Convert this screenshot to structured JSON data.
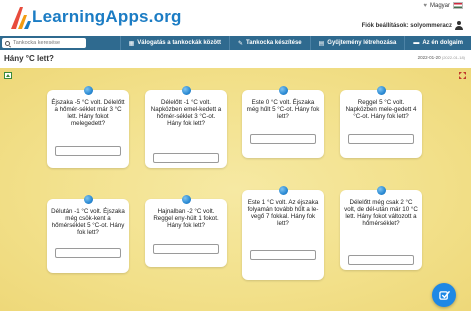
{
  "header": {
    "logo_text": "LearningApps.org",
    "language": "Magyar",
    "settings_link": "Fiók beállítások: solyommeracz"
  },
  "nav": {
    "search_placeholder": "Tankocka keresése",
    "items": [
      {
        "label": "Válogatás a tankockák között",
        "icon": "grid-icon"
      },
      {
        "label": "Tankocka készítése",
        "icon": "pencil-icon"
      },
      {
        "label": "Gyűjtemény létrehozása",
        "icon": "collection-icon"
      },
      {
        "label": "Az én dolgaim",
        "icon": "folder-icon"
      }
    ]
  },
  "page": {
    "title": "Hány °C lett?",
    "date": "2022-01-20",
    "date_small": "(2022-01-18)"
  },
  "cards": [
    {
      "text": "Éjszaka -5 °C volt. Délelőtt a hőmér-séklet már 3 °C lett. Hány fokot melegedett?",
      "answer": ""
    },
    {
      "text": "Délelőtt -1 °C volt. Napközben emel-kedett a hőmér-séklet 3 °C-ot. Hány fok lett?",
      "answer": ""
    },
    {
      "text": "Este 0 °C volt. Éjszaka még hűlt 5 °C-ot. Hány fok lett?",
      "answer": ""
    },
    {
      "text": "Reggel 5 °C volt. Napközben mele-gedett 4 °C-ot. Hány fok lett?",
      "answer": ""
    },
    {
      "text": "Délután -1 °C volt. Éjszaka még csök-kent a hőmérséklet 5 °C-ot. Hány fok lett?",
      "answer": ""
    },
    {
      "text": "Hajnalban -2 °C volt. Reggel eny-hült 1 fokot. Hány fok lett?",
      "answer": ""
    },
    {
      "text": "Este 1 °C volt. Az éjszaka folyamán tovább hűlt a le-vegő 7 fokkal. Hány fok lett?",
      "answer": ""
    },
    {
      "text": "Délelőtt még csak 2 °C volt, de dél-után már 10 °C lett. Hány fokot változott a hőmérséklet?",
      "answer": ""
    }
  ],
  "colors": {
    "brand": "#1b7cc4",
    "nav": "#2f6a8f",
    "stage": "#f2e08a",
    "pin": "#2a8ad4",
    "check_button": "#1e88e5"
  }
}
